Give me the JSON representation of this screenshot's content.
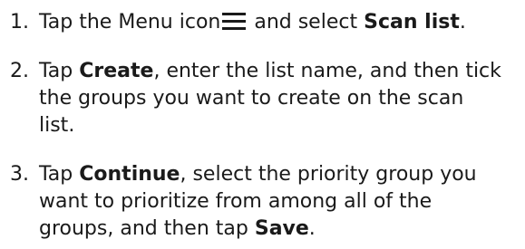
{
  "steps": [
    {
      "number": "1.",
      "line1": {
        "pre": "Tap the Menu icon",
        "icon": "menu-icon",
        "mid": " and select ",
        "bold": "Scan list",
        "post": "."
      }
    },
    {
      "number": "2.",
      "line1": {
        "pre": "Tap ",
        "bold": "Create",
        "post": ", enter the list name, and then tick"
      },
      "line2": "the groups you want to create on the scan",
      "line3": "list."
    },
    {
      "number": "3.",
      "line1": {
        "pre": "Tap ",
        "bold": "Continue",
        "post": ", select the priority group you"
      },
      "line2": "want to prioritize from among all of the",
      "line3": {
        "pre": "groups, and then tap ",
        "bold": "Save",
        "post": "."
      }
    }
  ]
}
